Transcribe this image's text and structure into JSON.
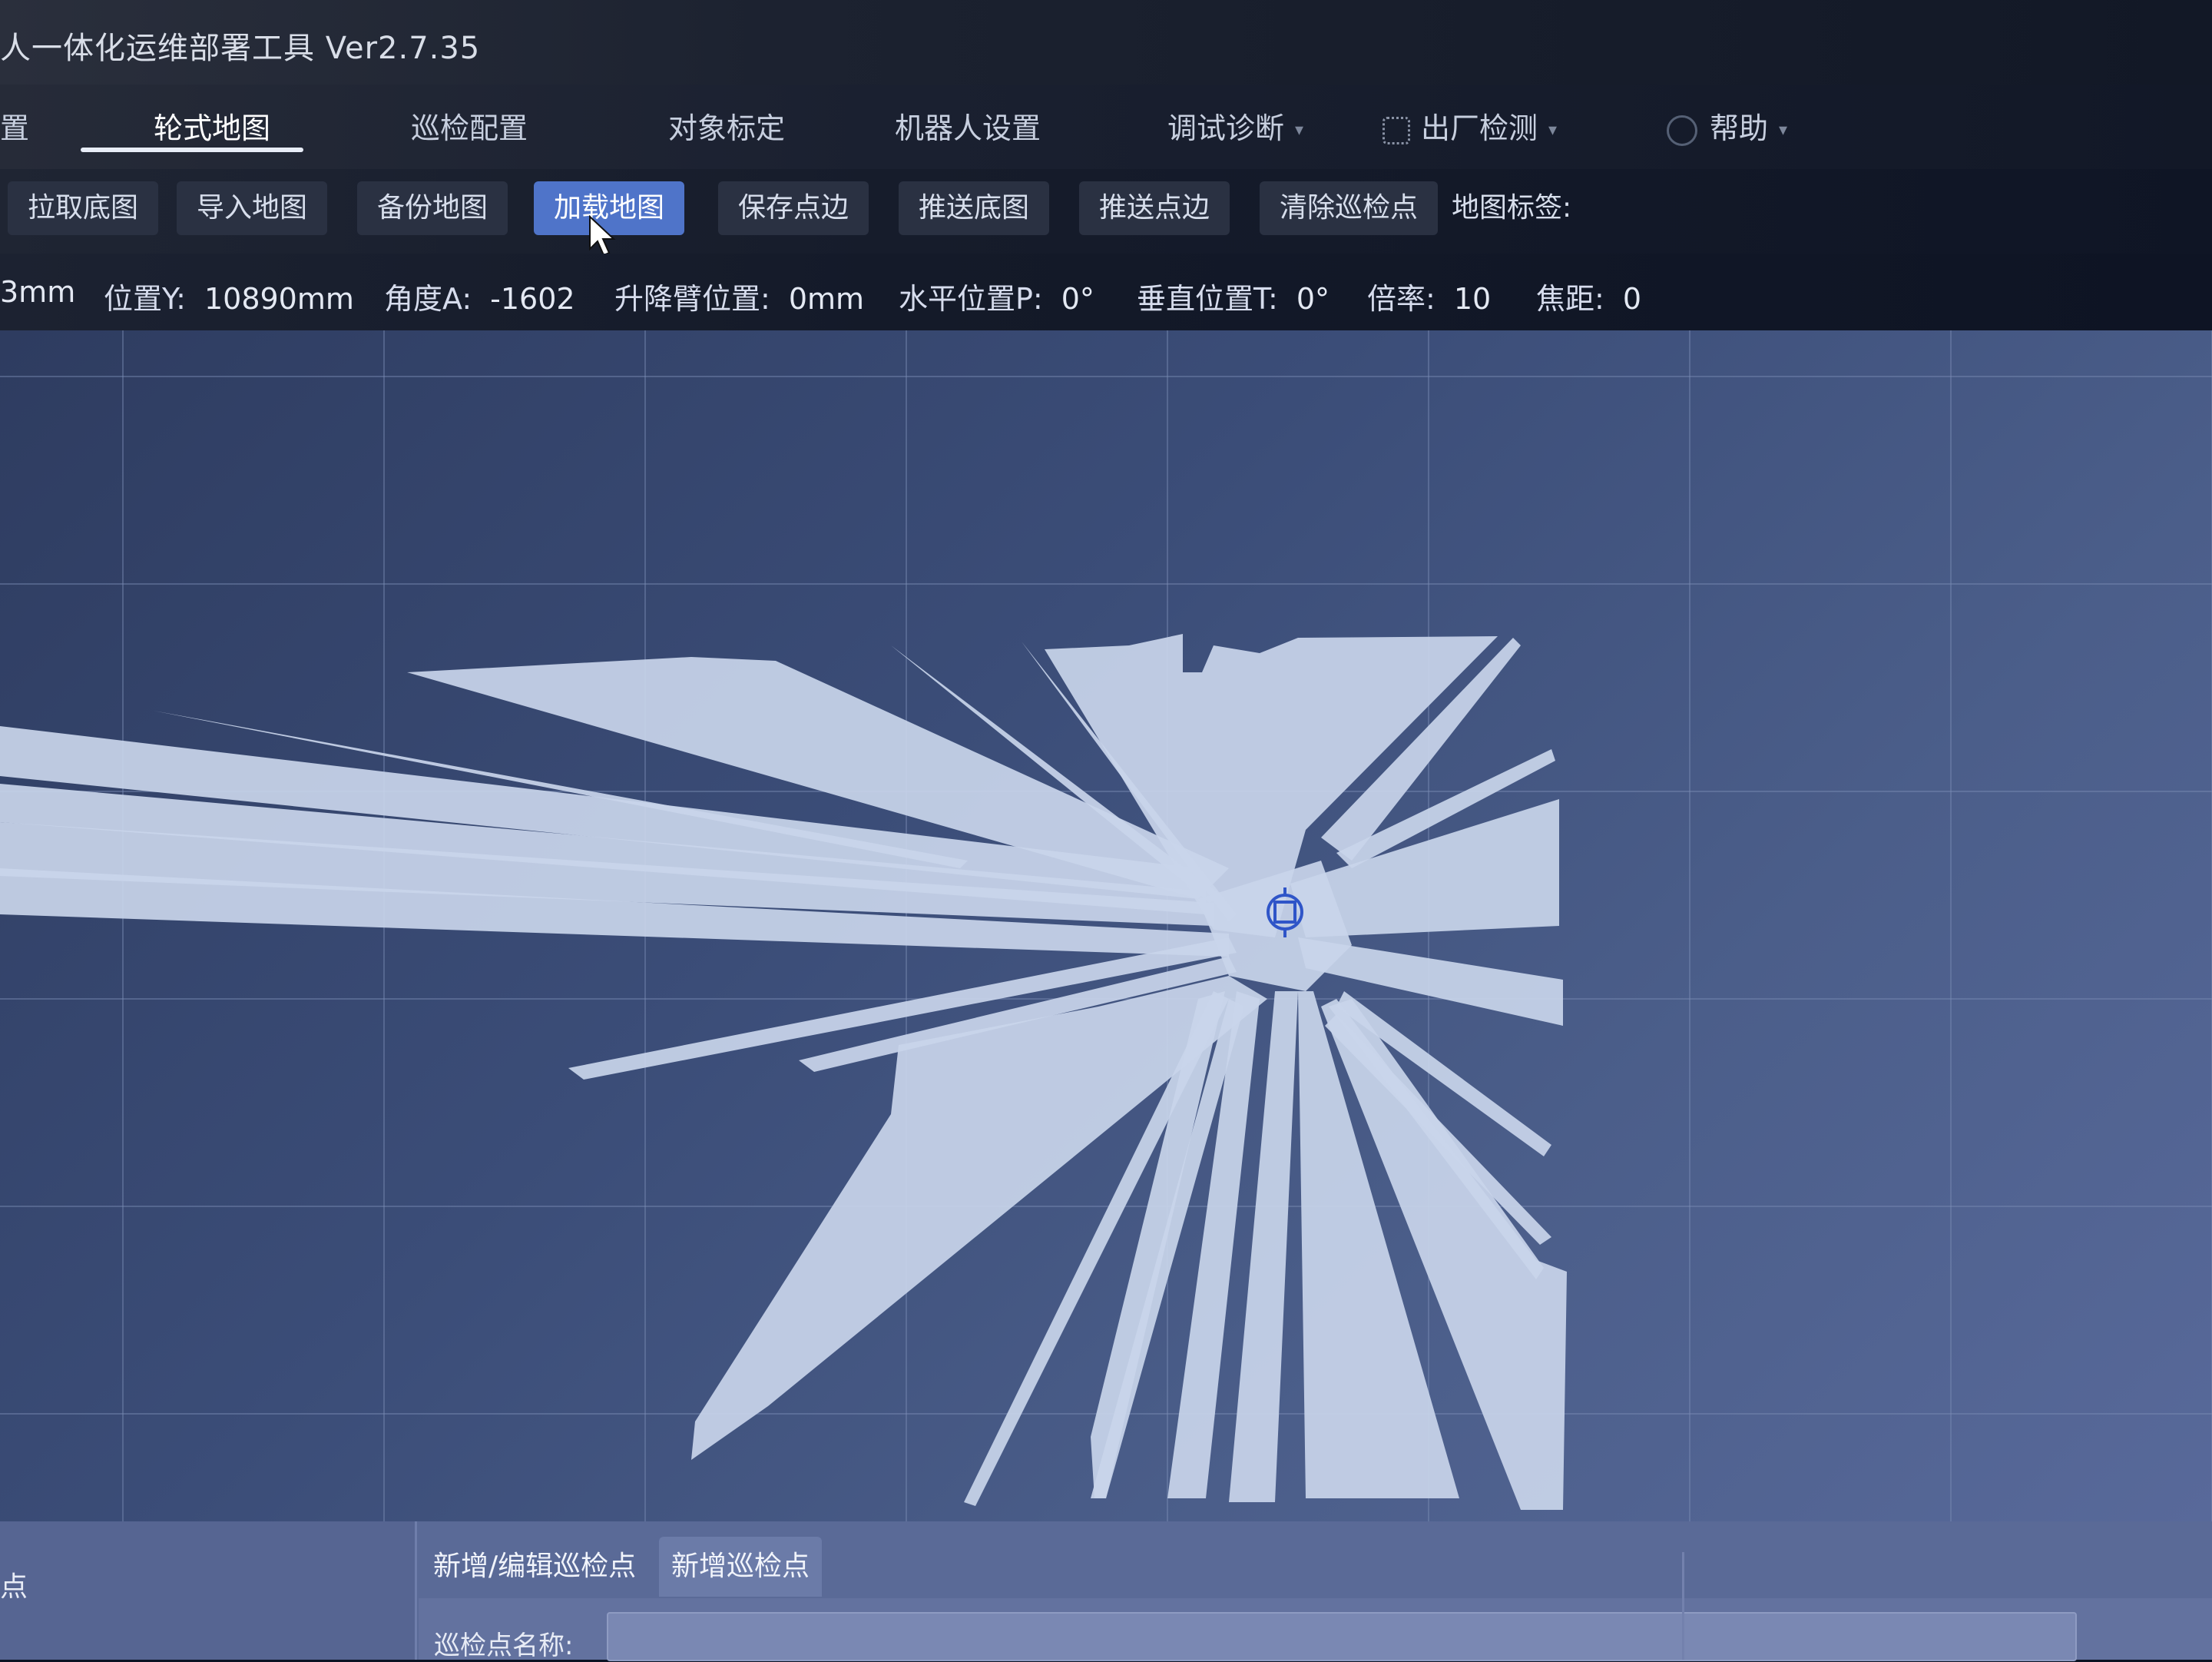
{
  "app": {
    "title": "人一体化运维部署工具  Ver2.7.35"
  },
  "main_nav": {
    "items": [
      {
        "label": "置"
      },
      {
        "label": "轮式地图"
      },
      {
        "label": "巡检配置"
      },
      {
        "label": "对象标定"
      },
      {
        "label": "机器人设置"
      },
      {
        "label": "调试诊断"
      },
      {
        "label": "出厂检测"
      },
      {
        "label": "帮助"
      }
    ],
    "active": "轮式地图"
  },
  "toolbar": {
    "buttons": [
      {
        "label": "拉取底图"
      },
      {
        "label": "导入地图"
      },
      {
        "label": "备份地图"
      },
      {
        "label": "加载地图"
      },
      {
        "label": "保存点边"
      },
      {
        "label": "推送底图"
      },
      {
        "label": "推送点边"
      },
      {
        "label": "清除巡检点"
      }
    ],
    "map_tag_label": "地图标签:"
  },
  "status": {
    "pos_x_value": "3mm",
    "pos_y_label": "位置Y:",
    "pos_y_value": "10890mm",
    "angle_label": "角度A:",
    "angle_value": "-1602",
    "lift_label": "升降臂位置:",
    "lift_value": "0mm",
    "pan_label": "水平位置P:",
    "pan_value": "0°",
    "tilt_label": "垂直位置T:",
    "tilt_value": "0°",
    "zoom_label": "倍率:",
    "zoom_value": "10",
    "focus_label": "焦距:",
    "focus_value": "0"
  },
  "bottom_panel": {
    "left_text": "点",
    "tabs": [
      {
        "label": "新增/编辑巡检点"
      },
      {
        "label": "新增巡检点"
      }
    ],
    "field_label": "巡检点名称:"
  },
  "colors": {
    "accent": "#4f74c9",
    "map_free_space": "#c9d5ea",
    "robot_marker": "#2f55c8"
  }
}
